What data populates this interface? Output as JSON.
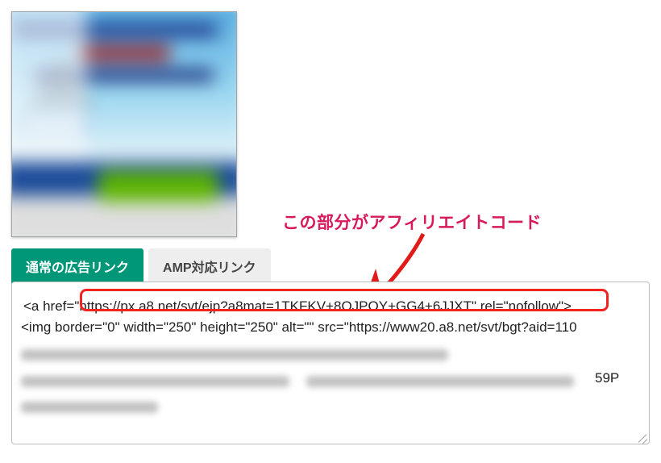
{
  "callout": {
    "label": "この部分がアフィリエイトコード"
  },
  "tabs": {
    "active_label": "通常の広告リンク",
    "inactive_label": "AMP対応リンク"
  },
  "code": {
    "line1_prefix": "<a href=\"",
    "line1_highlight": "https://px.a8.net/svt/ejp?a8mat=1TKFKV+8OJPOY+GG4+6JJXT\" rel=\"nofollow",
    "line1_suffix": "\">",
    "line2_start": "<img border=\"0\" width=\"250\" height=\"250\" alt=\"\" src=\"https://www20.a8.net/svt/bgt?aid=110",
    "line4_tail": "59P"
  }
}
